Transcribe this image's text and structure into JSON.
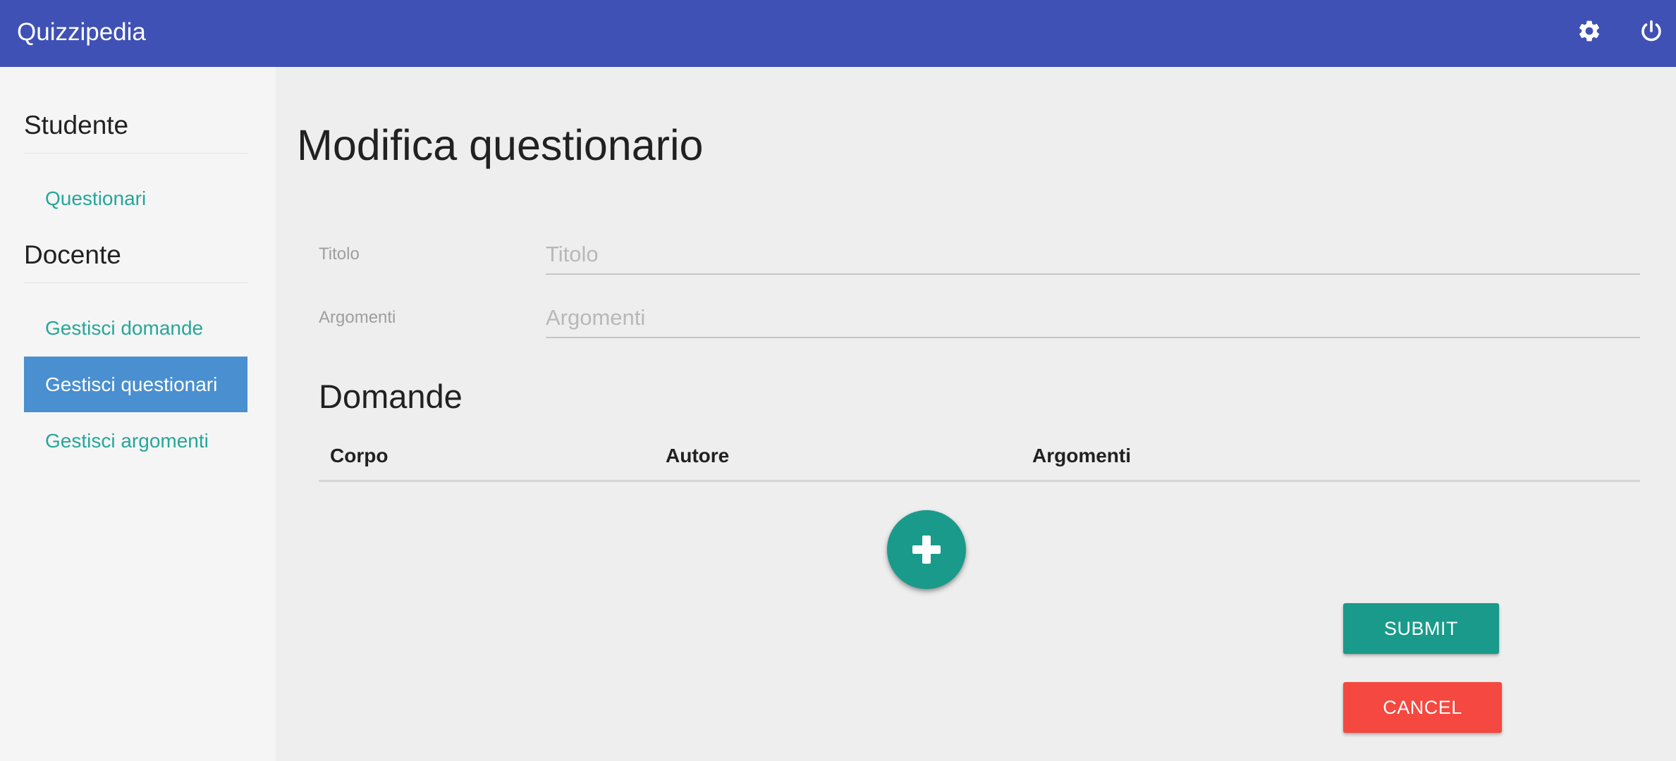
{
  "app": {
    "title": "Quizzipedia"
  },
  "topbar": {
    "icons": [
      "settings-icon",
      "power-icon"
    ]
  },
  "sidebar": {
    "sections": [
      {
        "heading": "Studente",
        "items": [
          {
            "label": "Questionari",
            "active": false
          }
        ]
      },
      {
        "heading": "Docente",
        "items": [
          {
            "label": "Gestisci domande",
            "active": false
          },
          {
            "label": "Gestisci questionari",
            "active": true
          },
          {
            "label": "Gestisci argomenti",
            "active": false
          }
        ]
      }
    ]
  },
  "main": {
    "title": "Modifica questionario",
    "form": {
      "titolo": {
        "label": "Titolo",
        "placeholder": "Titolo",
        "value": ""
      },
      "argomenti": {
        "label": "Argomenti",
        "placeholder": "Argomenti",
        "value": ""
      }
    },
    "questions": {
      "title": "Domande",
      "columns": [
        "Corpo",
        "Autore",
        "Argomenti"
      ],
      "rows": []
    },
    "add_icon": "plus-icon",
    "submit_label": "Submit",
    "cancel_label": "Cancel"
  },
  "colors": {
    "primary": "#3f51b5",
    "accent": "#1a9a8b",
    "link": "#26a69a",
    "active_item": "#4a8fcf",
    "danger": "#f44840"
  }
}
